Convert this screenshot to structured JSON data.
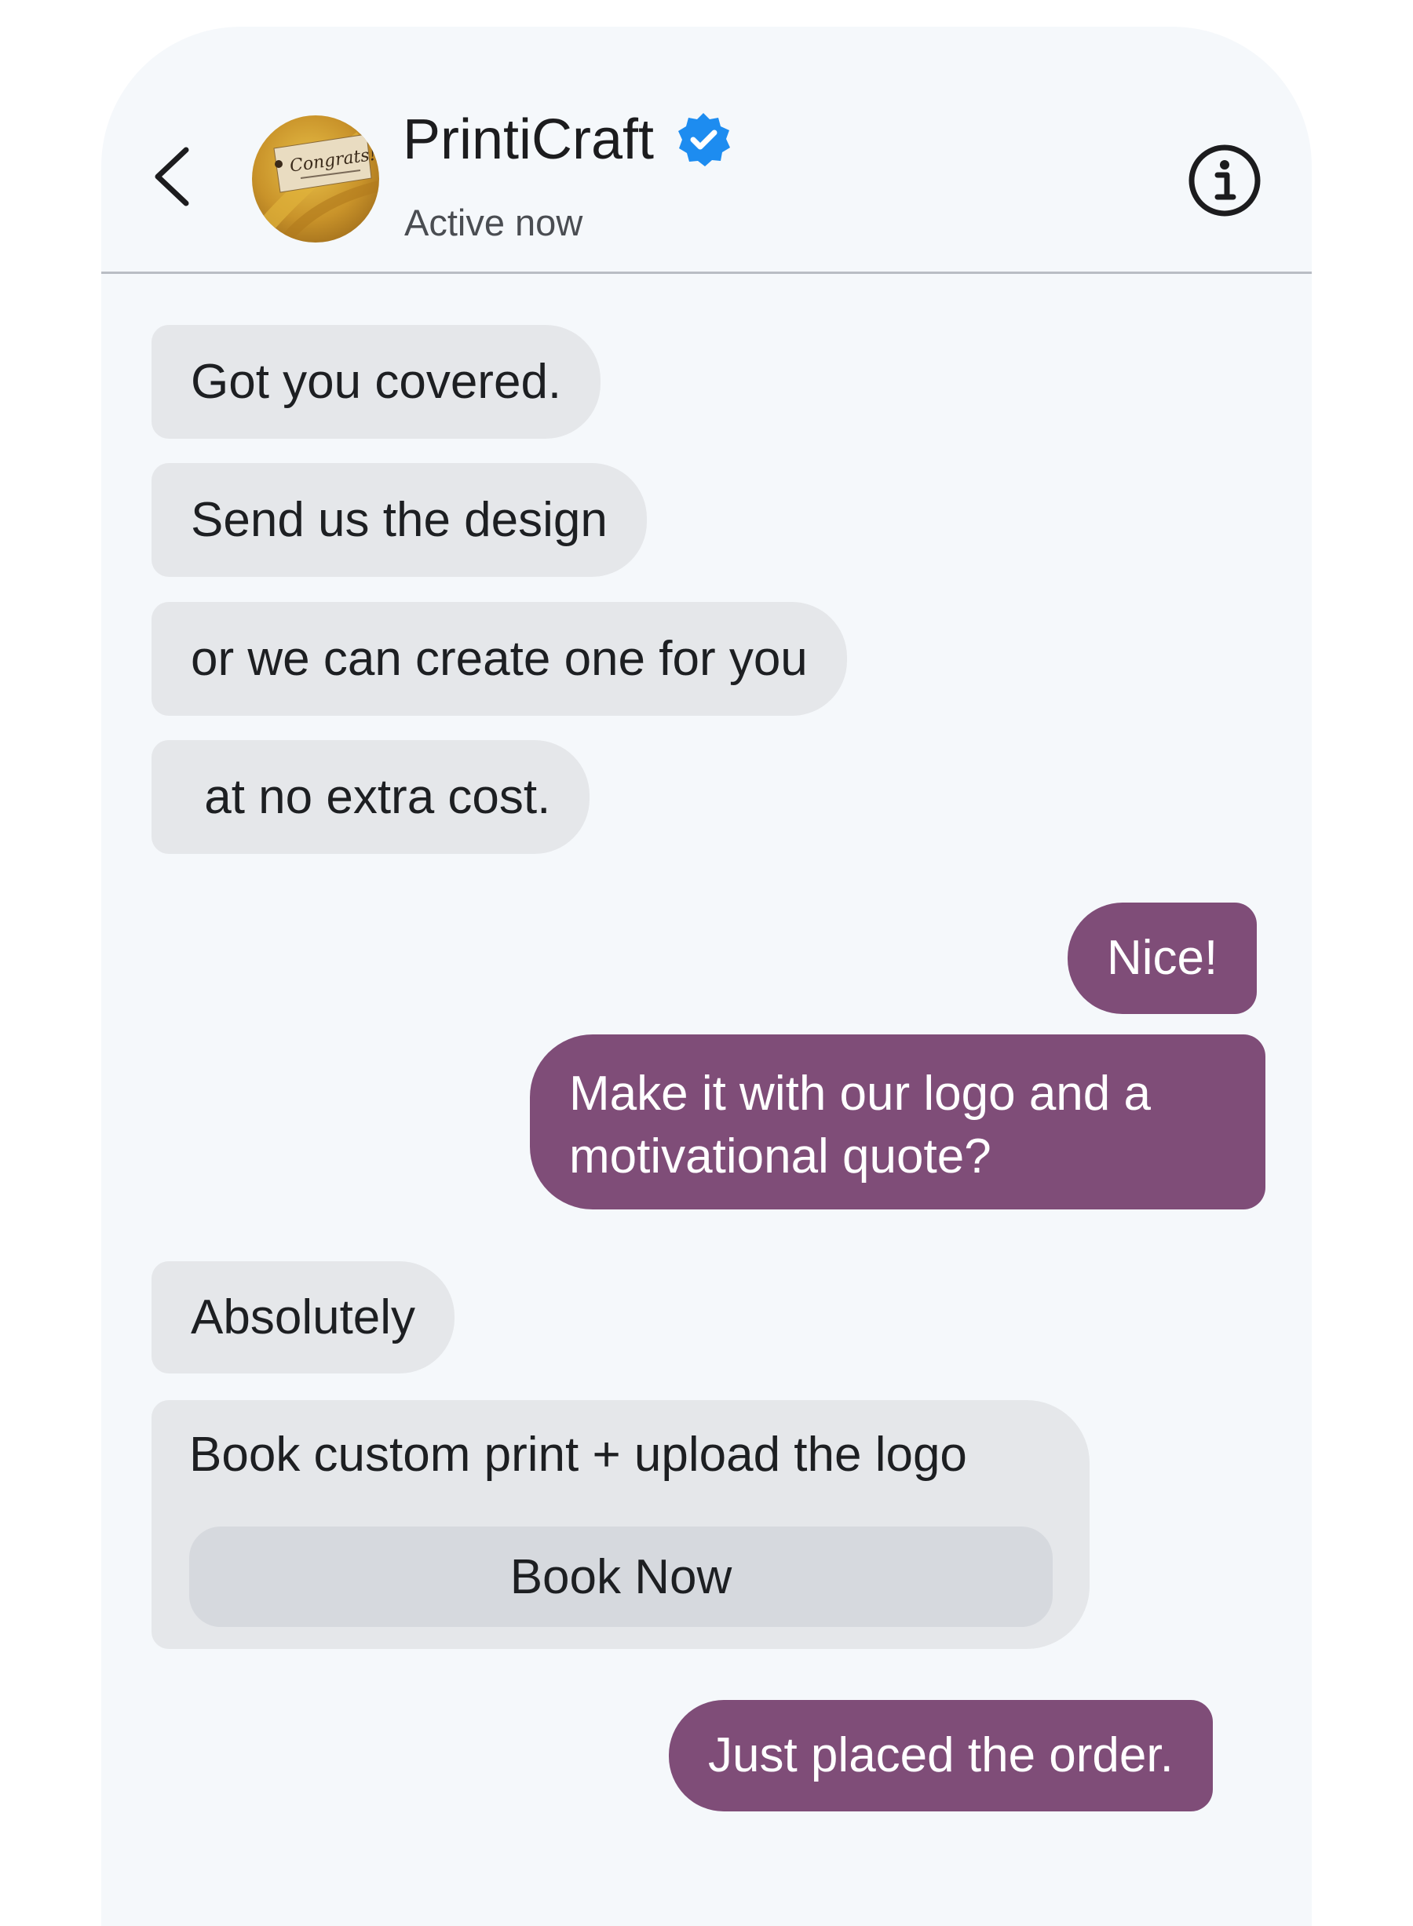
{
  "header": {
    "back_icon": "chevron-left-icon",
    "avatar_icon": "gift-tag-avatar",
    "avatar_text": "Congrats!",
    "title": "PrintiCraft",
    "verified_icon": "verified-badge-icon",
    "status": "Active now",
    "info_icon": "info-icon"
  },
  "messages": [
    {
      "from": "business",
      "text": "Got you covered."
    },
    {
      "from": "business",
      "text": "Send us the design"
    },
    {
      "from": "business",
      "text": "or we can create one for you"
    },
    {
      "from": "business",
      "text": " at no extra cost."
    },
    {
      "from": "user",
      "text": "Nice!"
    },
    {
      "from": "user",
      "text": "Make it with our logo and a motivational quote?"
    },
    {
      "from": "business",
      "text": "Absolutely"
    },
    {
      "from": "user",
      "text": "Just placed the order."
    }
  ],
  "card": {
    "text": "Book custom print + upload the logo",
    "button_label": "Book Now"
  },
  "colors": {
    "incoming_bubble": "#e5e7ea",
    "outgoing_bubble": "#7f4d78",
    "verified": "#1d8cf0",
    "background": "#f5f8fb"
  }
}
